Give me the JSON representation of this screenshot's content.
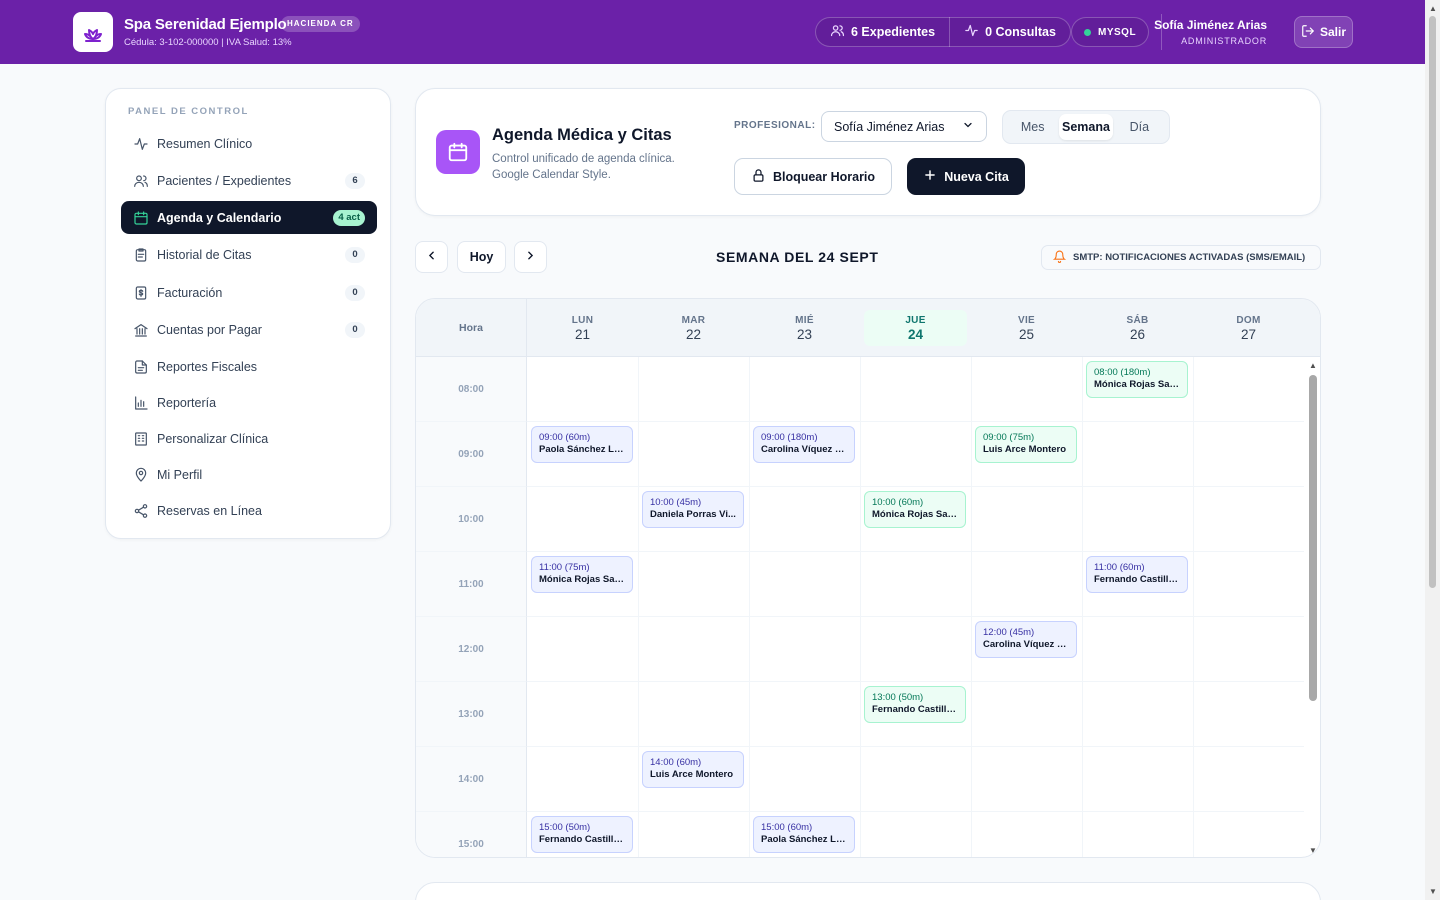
{
  "brand": {
    "name": "Spa Serenidad Ejemplo",
    "badge": "HACIENDA CR",
    "subtitle": "Cédula: 3-102-000000 | IVA Salud: 13%"
  },
  "topbar": {
    "expedientes": "6 Expedientes",
    "consultas": "0 Consultas",
    "db": "MYSQL",
    "user_name": "Sofía Jiménez Arias",
    "user_role": "ADMINISTRADOR",
    "logout": "Salir"
  },
  "sidebar": {
    "heading": "PANEL DE CONTROL",
    "items": [
      {
        "label": "Resumen Clínico",
        "count": "",
        "icon": "activity-icon"
      },
      {
        "label": "Pacientes / Expedientes",
        "count": "6",
        "icon": "users-icon"
      },
      {
        "label": "Agenda y Calendario",
        "count": "4 act",
        "icon": "calendar-icon",
        "active": true
      },
      {
        "label": "Historial de Citas",
        "count": "0",
        "icon": "clipboard-icon"
      },
      {
        "label": "Facturación",
        "count": "0",
        "icon": "dollar-file-icon"
      },
      {
        "label": "Cuentas por Pagar",
        "count": "0",
        "icon": "bank-icon"
      },
      {
        "label": "Reportes Fiscales",
        "count": "",
        "icon": "document-icon"
      },
      {
        "label": "Reportería",
        "count": "",
        "icon": "bar-chart-icon"
      },
      {
        "label": "Personalizar Clínica",
        "count": "",
        "icon": "building-icon"
      },
      {
        "label": "Mi Perfil",
        "count": "",
        "icon": "map-pin-icon"
      },
      {
        "label": "Reservas en Línea",
        "count": "",
        "icon": "share-icon"
      }
    ]
  },
  "header": {
    "title": "Agenda Médica y Citas",
    "subtitle": "Control unificado de agenda clínica. Google Calendar Style.",
    "professional_label": "PROFESIONAL:",
    "professional_value": "Sofía Jiménez Arias",
    "views": [
      "Mes",
      "Semana",
      "Día"
    ],
    "selected_view": "Semana",
    "block_button": "Bloquear Horario",
    "new_button": "Nueva Cita"
  },
  "weeknav": {
    "today": "Hoy",
    "title": "SEMANA DEL 24 SEPT",
    "smtp": "SMTP: NOTIFICACIONES ACTIVADAS (SMS/EMAIL)"
  },
  "calendar": {
    "hour_label": "Hora",
    "days": [
      {
        "name": "LUN",
        "num": "21"
      },
      {
        "name": "MAR",
        "num": "22"
      },
      {
        "name": "MIÉ",
        "num": "23"
      },
      {
        "name": "JUE",
        "num": "24",
        "today": true
      },
      {
        "name": "VIE",
        "num": "25"
      },
      {
        "name": "SÁB",
        "num": "26"
      },
      {
        "name": "DOM",
        "num": "27"
      }
    ],
    "hours": [
      "08:00",
      "09:00",
      "10:00",
      "11:00",
      "12:00",
      "13:00",
      "14:00",
      "15:00"
    ],
    "events": [
      {
        "day": 5,
        "hour": 0,
        "time": "08:00 (180m)",
        "name": "Mónica Rojas Sal...",
        "color": "green"
      },
      {
        "day": 0,
        "hour": 1,
        "time": "09:00 (60m)",
        "name": "Paola Sánchez León",
        "color": "blue"
      },
      {
        "day": 2,
        "hour": 1,
        "time": "09:00 (180m)",
        "name": "Carolina Víquez S...",
        "color": "blue"
      },
      {
        "day": 4,
        "hour": 1,
        "time": "09:00 (75m)",
        "name": "Luis Arce Montero",
        "color": "green"
      },
      {
        "day": 1,
        "hour": 2,
        "time": "10:00 (45m)",
        "name": "Daniela Porras Vi...",
        "color": "blue"
      },
      {
        "day": 3,
        "hour": 2,
        "time": "10:00 (60m)",
        "name": "Mónica Rojas Sal...",
        "color": "green"
      },
      {
        "day": 0,
        "hour": 3,
        "time": "11:00 (75m)",
        "name": "Mónica Rojas Sal...",
        "color": "blue"
      },
      {
        "day": 5,
        "hour": 3,
        "time": "11:00 (60m)",
        "name": "Fernando Castillo...",
        "color": "blue"
      },
      {
        "day": 4,
        "hour": 4,
        "time": "12:00 (45m)",
        "name": "Carolina Víquez S...",
        "color": "blue"
      },
      {
        "day": 3,
        "hour": 5,
        "time": "13:00 (50m)",
        "name": "Fernando Castillo...",
        "color": "green"
      },
      {
        "day": 1,
        "hour": 6,
        "time": "14:00 (60m)",
        "name": "Luis Arce Montero",
        "color": "blue"
      },
      {
        "day": 0,
        "hour": 7,
        "time": "15:00 (50m)",
        "name": "Fernando Castillo...",
        "color": "blue"
      },
      {
        "day": 2,
        "hour": 7,
        "time": "15:00 (60m)",
        "name": "Paola Sánchez León",
        "color": "blue"
      }
    ]
  },
  "colors": {
    "brand": "#6b21a8",
    "accent": "#a855f7",
    "dark": "#0f172a"
  }
}
